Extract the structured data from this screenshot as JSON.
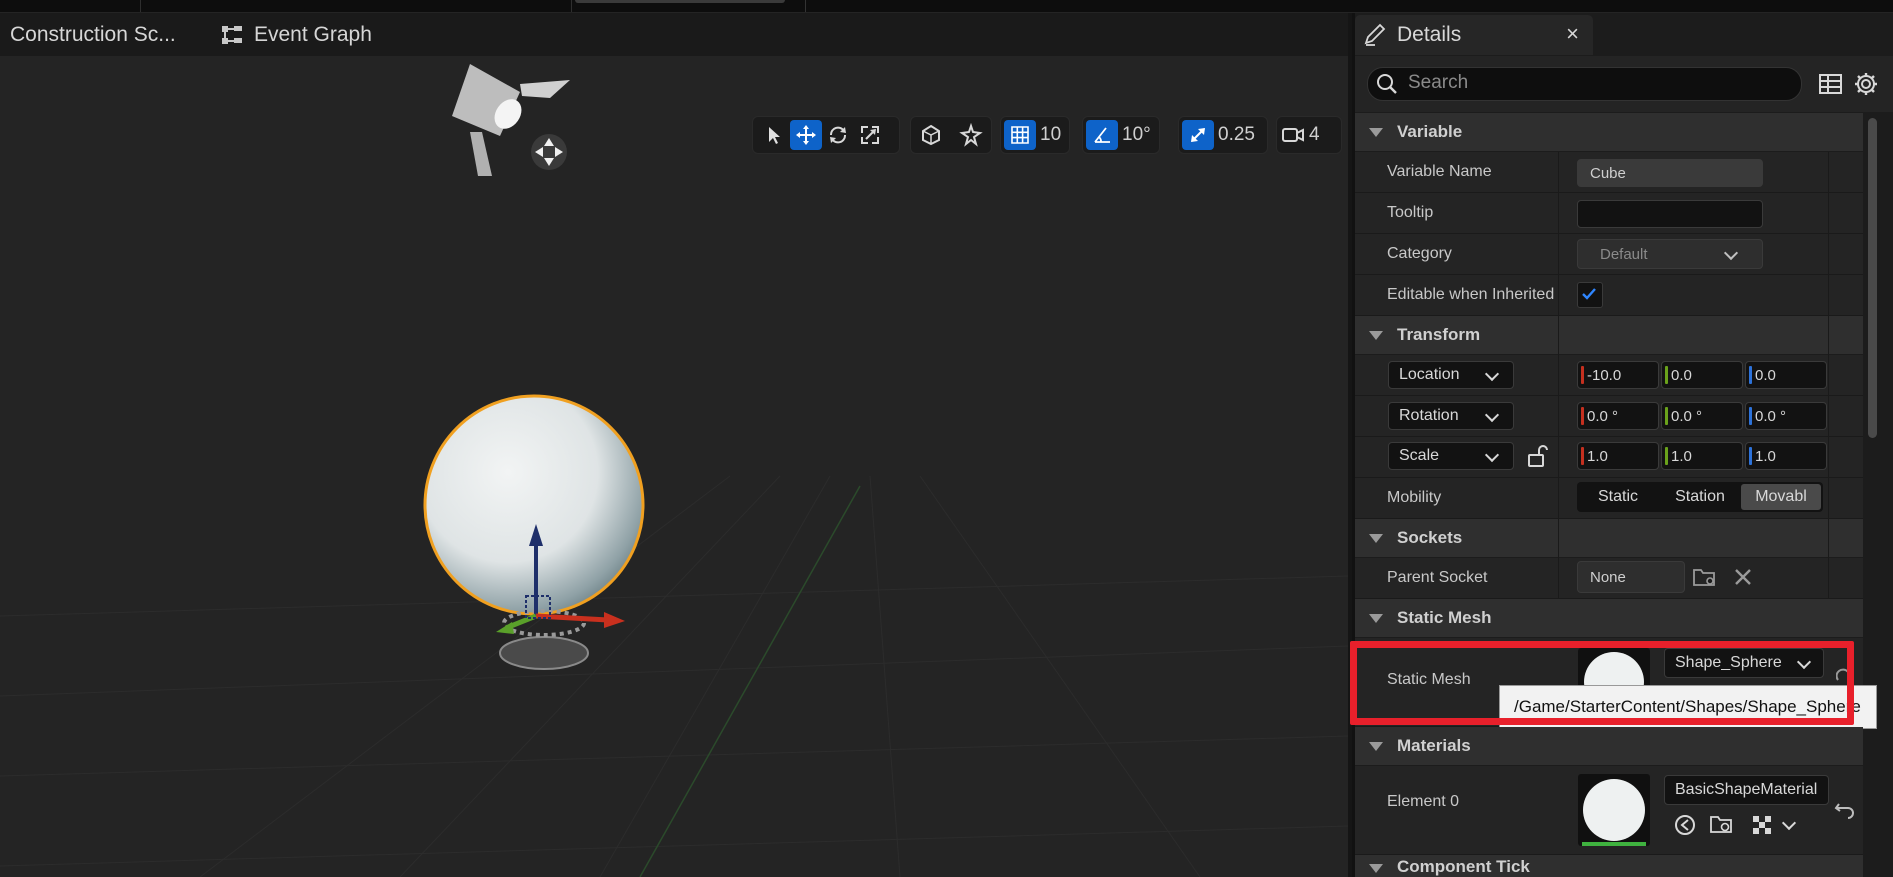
{
  "graph_tabs": {
    "construction_label": "Construction Sc...",
    "event_graph_label": "Event Graph"
  },
  "viewport_toolbar": {
    "grid_snap": "10",
    "angle_snap": "10°",
    "scale_snap": "0.25",
    "camera_speed": "4"
  },
  "details": {
    "title": "Details",
    "search_placeholder": "Search",
    "sections": {
      "variable": "Variable",
      "transform": "Transform",
      "sockets": "Sockets",
      "static_mesh": "Static Mesh",
      "materials": "Materials",
      "component_tick": "Component Tick"
    },
    "variable": {
      "name_label": "Variable Name",
      "name_value": "Cube",
      "tooltip_label": "Tooltip",
      "tooltip_value": "",
      "category_label": "Category",
      "category_value": "Default",
      "editable_label": "Editable when Inherited",
      "editable_checked": true
    },
    "transform": {
      "location_label": "Location",
      "location": [
        "-10.0",
        "0.0",
        "0.0"
      ],
      "rotation_label": "Rotation",
      "rotation": [
        "0.0 °",
        "0.0 °",
        "0.0 °"
      ],
      "scale_label": "Scale",
      "scale": [
        "1.0",
        "1.0",
        "1.0"
      ],
      "mobility_label": "Mobility",
      "mobility_options": [
        "Static",
        "Station",
        "Movabl"
      ],
      "mobility_selected": "Movabl"
    },
    "sockets": {
      "parent_label": "Parent Socket",
      "parent_value": "None"
    },
    "static_mesh": {
      "label": "Static Mesh",
      "value": "Shape_Sphere",
      "tooltip": "/Game/StarterContent/Shapes/Shape_Sphere"
    },
    "materials": {
      "element_label": "Element 0",
      "element_value": "BasicShapeMaterial"
    }
  },
  "colors": {
    "accent": "#0e63c9",
    "highlight_box": "#e8202b",
    "selection_outline": "#f0a020"
  }
}
